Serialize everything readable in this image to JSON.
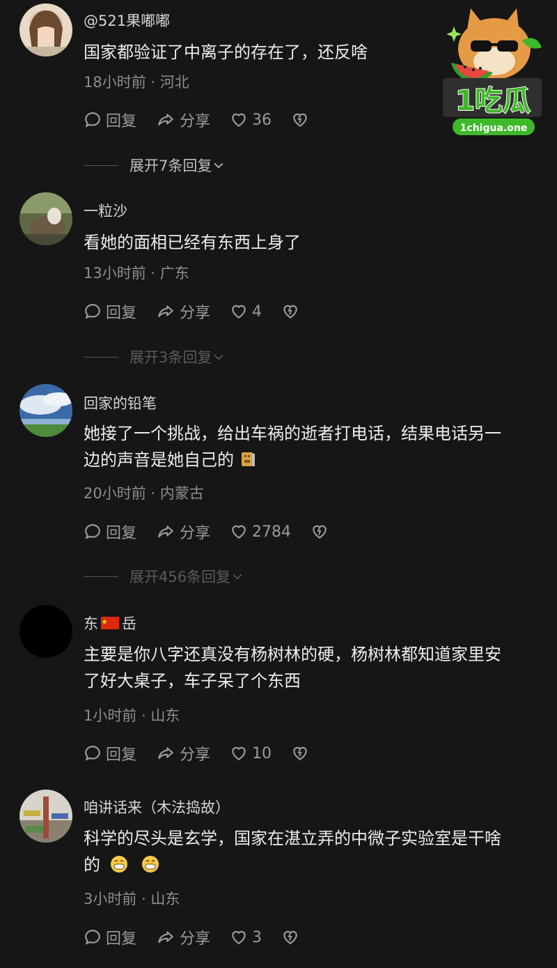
{
  "comments": [
    {
      "username": "@521果嘟嘟",
      "text": "国家都验证了中离子的存在了，还反啥",
      "meta": "18小时前 · 河北",
      "reply_label": "回复",
      "share_label": "分享",
      "likes": "36",
      "expand_label": "展开7条回复"
    },
    {
      "username": "一粒沙",
      "text": "看她的面相已经有东西上身了",
      "meta": "13小时前 · 广东",
      "reply_label": "回复",
      "share_label": "分享",
      "likes": "4",
      "expand_label": "展开3条回复"
    },
    {
      "username": "回家的铅笔",
      "text_line1": "她接了一个挑战，给出车祸的逝者打电话，结果电话另一",
      "text_line2": "边的声音是她自己的",
      "meta": "20小时前 · 内蒙古",
      "reply_label": "回复",
      "share_label": "分享",
      "likes": "2784",
      "expand_label": "展开456条回复"
    },
    {
      "username_a": "东",
      "username_b": "岳",
      "text_line1": "主要是你八字还真没有杨树林的硬，杨树林都知道家里安",
      "text_line2": "了好大桌子，车子呆了个东西",
      "meta": "1小时前 · 山东",
      "reply_label": "回复",
      "share_label": "分享",
      "likes": "10"
    },
    {
      "username": "咱讲话来（木法捣故）",
      "text_line1": "科学的尽头是玄学，国家在湛立弄的中微子实验室是干啥",
      "text_line2": "的",
      "meta": "3小时前 · 山东",
      "reply_label": "回复",
      "share_label": "分享",
      "likes": "3"
    }
  ],
  "watermark": {
    "brand": "1吃瓜",
    "url": "1chigua.one"
  },
  "colors": {
    "background": "#161616",
    "text": "#ededed",
    "muted": "#8e8e8e",
    "brand_green": "#3fb82a"
  }
}
